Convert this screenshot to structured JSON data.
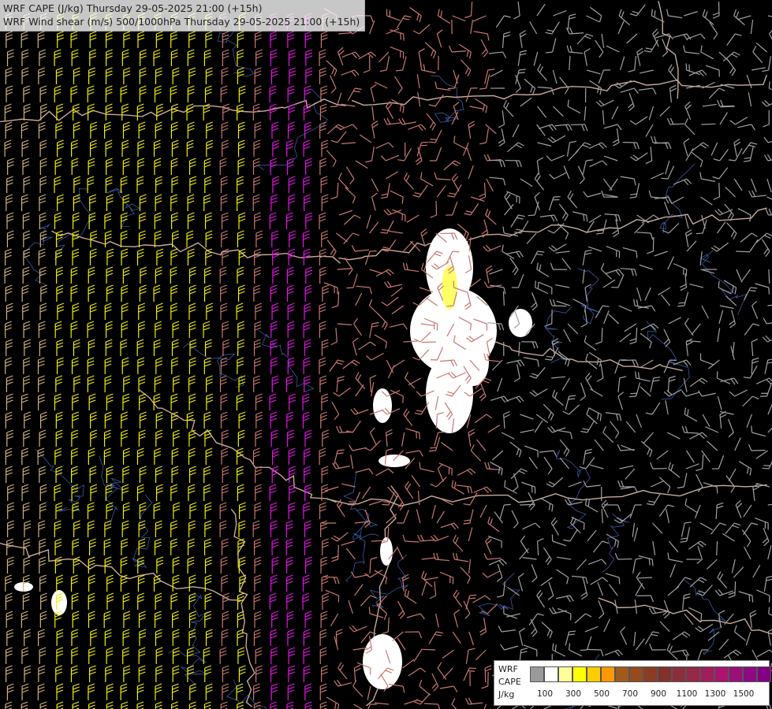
{
  "titles": {
    "line1": "WRF CAPE (J/kg) Thursday 29-05-2025 21:00 (+15h)",
    "line2": "WRF Wind shear (m/s) 500/1000hPa Thursday 29-05-2025 21:00 (+15h)"
  },
  "legend": {
    "model": "WRF",
    "variable": "CAPE",
    "unit": "J/kg",
    "colors": [
      "#9a9a9a",
      "#ffffff",
      "#ffff99",
      "#ffff00",
      "#ffcc00",
      "#ff9900",
      "#a05a1e",
      "#964b1e",
      "#8c3c24",
      "#82322a",
      "#8c2f3c",
      "#962848",
      "#a01e5a",
      "#aa146e",
      "#9a0f78",
      "#8c0a82",
      "#820082"
    ],
    "tick_labels": [
      "100",
      "300",
      "500",
      "700",
      "900",
      "1100",
      "1300",
      "1500"
    ]
  },
  "map_colors": {
    "background": "#000000",
    "border": "#c8aa9a",
    "river": "#3c5aa0",
    "shear_weak": "#a0a0a0",
    "shear_moderate": "#c87870",
    "shear_strong": "#d2b478",
    "shear_very_strong": "#f0f000",
    "shear_extreme": "#e614e6",
    "cape_low": "#ffffff",
    "cape_mid": "#ffff66"
  }
}
